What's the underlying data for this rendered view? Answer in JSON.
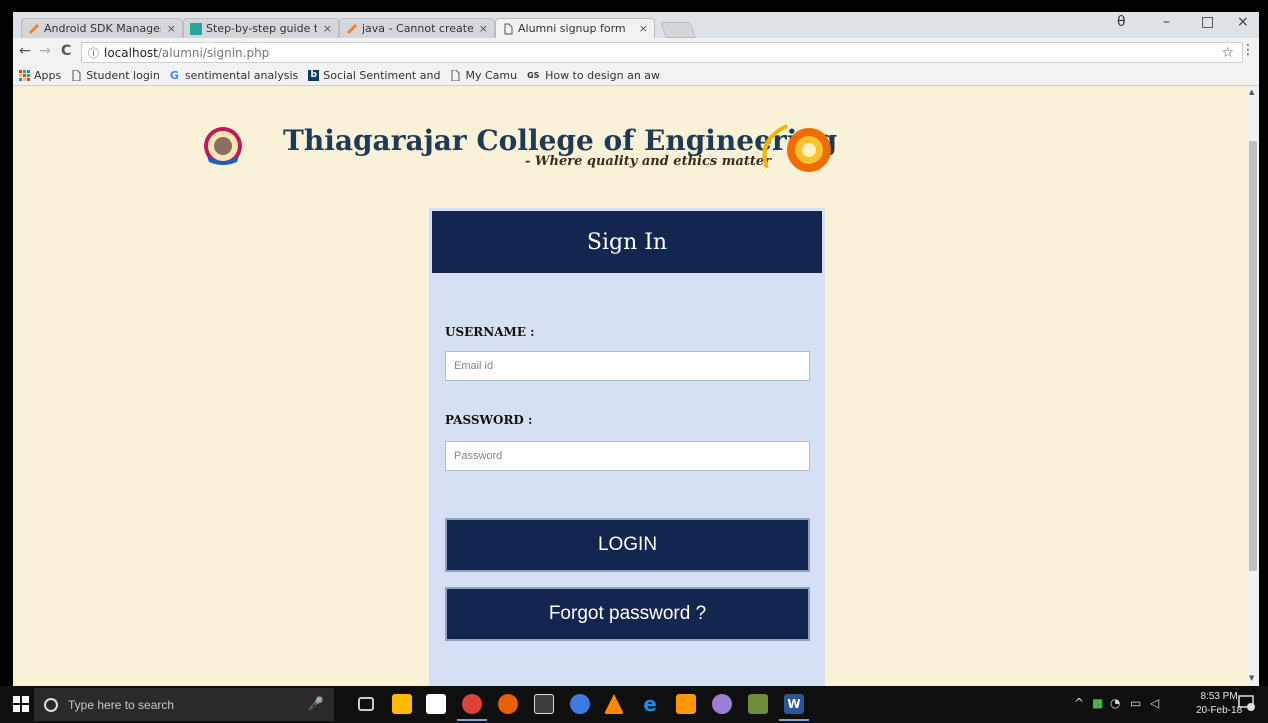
{
  "tabs": [
    {
      "title": "Android SDK Manager N",
      "close": "×"
    },
    {
      "title": "Step-by-step guide to An",
      "close": "×"
    },
    {
      "title": "java - Cannot create or e",
      "close": "×"
    },
    {
      "title": "Alumni signup form",
      "close": "×"
    }
  ],
  "address": {
    "host": "localhost",
    "path": "/alumni/signin.php"
  },
  "bookmarks": [
    "Apps",
    "Student login",
    "sentimental analysis",
    "Social Sentiment and",
    "My Camu",
    "How to design an aw"
  ],
  "page": {
    "college_name": "Thiagarajar College of Engineering",
    "tagline": "- Where quality and ethics matter",
    "signin_title": "Sign In",
    "username_label": "USERNAME :",
    "username_placeholder": "Email id",
    "password_label": "PASSWORD :",
    "password_placeholder": "Password",
    "login_label": "LOGIN",
    "forgot_label": "Forgot password ?"
  },
  "taskbar": {
    "search_placeholder": "Type here to search",
    "time": "8:53 PM",
    "date": "20-Feb-18"
  },
  "icons": {
    "back": "←",
    "forward": "→",
    "reload": "C",
    "info": "ⓘ",
    "star": "☆",
    "menu": "⋮",
    "profile": "θ",
    "minimize": "–",
    "maximize": "□",
    "close": "×"
  },
  "colors": {
    "page_bg": "#f9f2d8",
    "card_bg": "#d6e0f5",
    "navy": "#13264f"
  }
}
